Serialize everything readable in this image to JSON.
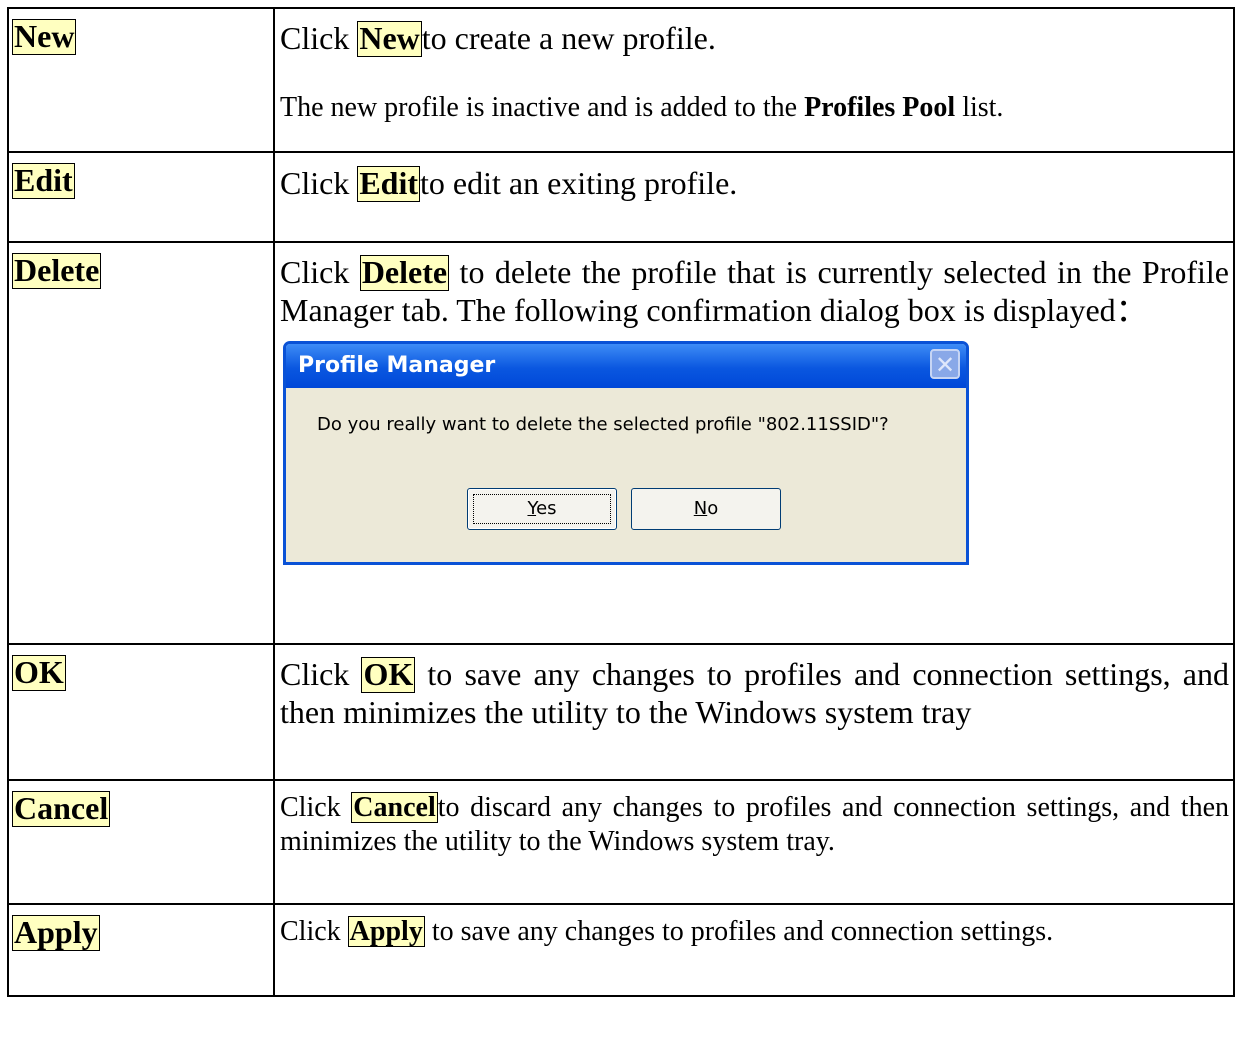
{
  "rows": [
    {
      "label": "New",
      "desc": {
        "pre": "Click ",
        "btn": "New ",
        "post": "to create a new profile."
      },
      "note": {
        "pre": "The new profile is inactive and is added to the ",
        "bold": "Profiles Pool",
        "post": " list."
      }
    },
    {
      "label": "Edit",
      "desc": {
        "pre": "Click ",
        "btn": "Edit ",
        "post": "to edit an exiting profile."
      }
    },
    {
      "label": "Delete",
      "desc": {
        "pre": "Click ",
        "btn": "Delete",
        "post": " to delete the profile that is currently selected in the Profile Manager tab. The following confirmation dialog box is displayed："
      },
      "dialog": {
        "title": "Profile Manager",
        "close_glyph": "✕",
        "message": "Do you really want to delete the selected profile \"802.11SSID\"?",
        "yes_mnemonic": "Y",
        "yes_rest": "es",
        "no_mnemonic": "N",
        "no_rest": "o"
      }
    },
    {
      "label": "OK",
      "desc": {
        "pre": "Click ",
        "btn": "OK",
        "post": " to save any changes to profiles and connection settings, and then minimizes the utility to the Windows system tray"
      }
    },
    {
      "label": "Cancel",
      "desc": {
        "pre": "Click ",
        "btn": "Cancel ",
        "post": "to discard any changes to profiles and connection settings, and then minimizes the utility to the Windows system tray."
      }
    },
    {
      "label": "Apply",
      "desc": {
        "pre": "Click ",
        "btn": "Apply",
        "post": " to save any changes to profiles and connection settings."
      }
    }
  ],
  "colors": {
    "highlight": "#ffffc0",
    "titlebar": "#0a57e0",
    "dialog_bg": "#ece9d8"
  }
}
